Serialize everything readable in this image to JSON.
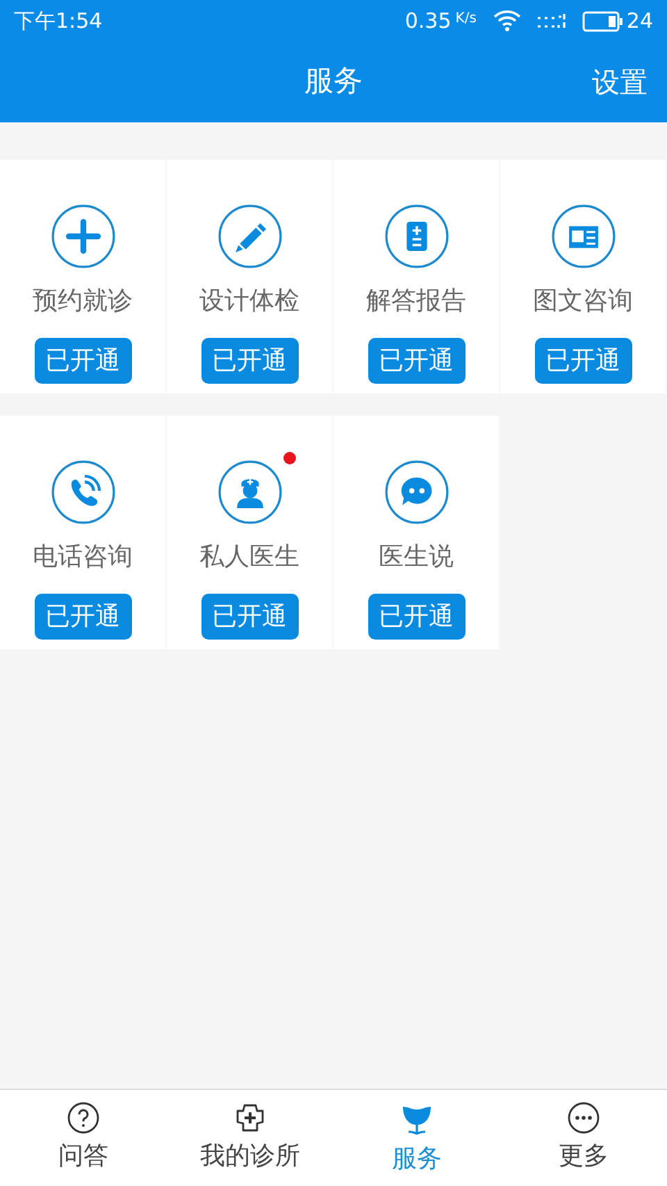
{
  "status_bar": {
    "time": "下午1:54",
    "speed": "0.35",
    "speed_unit": "K/s",
    "battery": "24"
  },
  "header": {
    "title": "服务",
    "action": "设置"
  },
  "services": [
    {
      "kind": "plus",
      "label": "预约就诊",
      "button": "已开通",
      "badge": false
    },
    {
      "kind": "pencil",
      "label": "设计体检",
      "button": "已开通",
      "badge": false
    },
    {
      "kind": "report",
      "label": "解答报告",
      "button": "已开通",
      "badge": false
    },
    {
      "kind": "article",
      "label": "图文咨询",
      "button": "已开通",
      "badge": false
    },
    {
      "kind": "phone",
      "label": "电话咨询",
      "button": "已开通",
      "badge": false
    },
    {
      "kind": "doctor",
      "label": "私人医生",
      "button": "已开通",
      "badge": true
    },
    {
      "kind": "chat",
      "label": "医生说",
      "button": "已开通",
      "badge": false
    }
  ],
  "tabs": [
    {
      "kind": "question",
      "label": "问答",
      "selected": false
    },
    {
      "kind": "clinic",
      "label": "我的诊所",
      "selected": false
    },
    {
      "kind": "flower",
      "label": "服务",
      "selected": true
    },
    {
      "kind": "more",
      "label": "更多",
      "selected": false
    }
  ]
}
